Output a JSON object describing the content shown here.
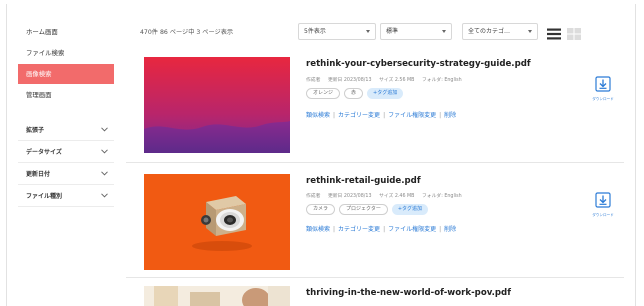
{
  "sidebar": {
    "nav": [
      {
        "label": "ホーム画面",
        "active": false
      },
      {
        "label": "ファイル検索",
        "active": false
      },
      {
        "label": "画像検索",
        "active": true
      },
      {
        "label": "管理画面",
        "active": false
      }
    ],
    "filters": [
      "拡張子",
      "データサイズ",
      "更新日付",
      "ファイル種別"
    ]
  },
  "toolbar": {
    "result_count": "470件 86 ページ中 3 ページ表示",
    "per_page": "5件表示",
    "sort": "標準",
    "category": "全てのカテゴ…",
    "view_icons": [
      "list-view-icon",
      "grid-view-icon"
    ]
  },
  "results": [
    {
      "title": "rethink-your-cybersecurity-strategy-guide.pdf",
      "meta": [
        "作成者",
        "更新日 2023/08/13",
        "サイズ 2.56 MB",
        "フォルダ: English"
      ],
      "tags": [
        "オレンジ",
        "赤"
      ],
      "add_tag": "+タグ追加",
      "actions": [
        "類似検索",
        "カテゴリー変更",
        "ファイル権限変更",
        "削除"
      ],
      "download": "ダウンロード",
      "colors": {
        "thumb_top": "#e8273f",
        "thumb_bottom": "#7a2a90"
      }
    },
    {
      "title": "rethink-retail-guide.pdf",
      "meta": [
        "作成者",
        "更新日 2023/08/13",
        "サイズ 2.46 MB",
        "フォルダ: English"
      ],
      "tags": [
        "カメラ",
        "プロジェクター"
      ],
      "add_tag": "+タグ追加",
      "actions": [
        "類似検索",
        "カテゴリー変更",
        "ファイル権限変更",
        "削除"
      ],
      "download": "ダウンロード",
      "colors": {
        "thumb_top": "#f15a12",
        "thumb_bottom": "#f15a12"
      }
    },
    {
      "title": "thriving-in-the-new-world-of-work-pov.pdf"
    }
  ],
  "colors": {
    "accent": "#f26b6b",
    "link": "#2b7bd6",
    "tag_add_bg": "#d9ebfb"
  }
}
